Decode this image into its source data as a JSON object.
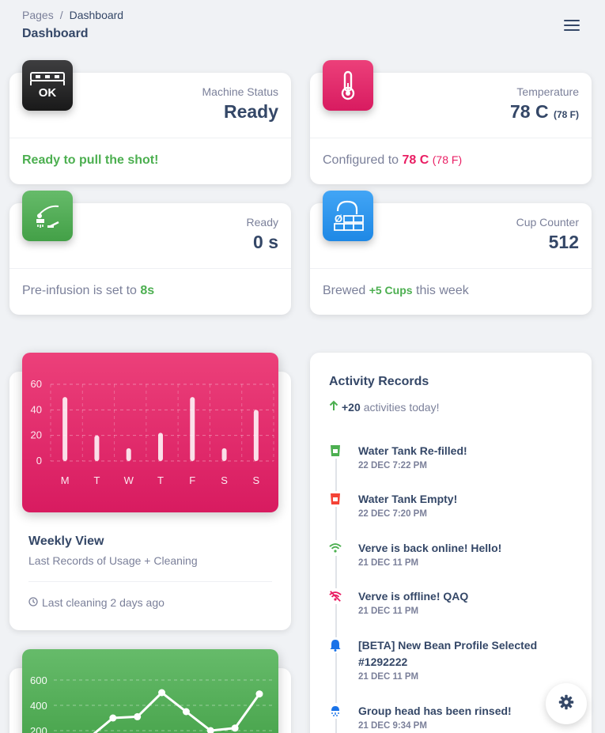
{
  "breadcrumb": {
    "root": "Pages",
    "separator": "/",
    "current": "Dashboard"
  },
  "page_title": "Dashboard",
  "stats": {
    "machine": {
      "label": "Machine Status",
      "value": "Ready",
      "footer": "Ready to pull the shot!",
      "icon": "machine-ok-icon",
      "icon_text": "OK"
    },
    "temperature": {
      "label": "Temperature",
      "value": "78 C",
      "value_sub": "(78 F)",
      "footer_prefix": "Configured to",
      "footer_value": "78 C",
      "footer_sub": "(78 F)",
      "icon": "thermometer-icon"
    },
    "ready": {
      "label": "Ready",
      "value": "0 s",
      "footer_prefix": "Pre-infusion is set to",
      "footer_value": "8s",
      "icon": "group-head-icon"
    },
    "cups": {
      "label": "Cup Counter",
      "value": "512",
      "footer_prefix": "Brewed",
      "footer_value": "+5 Cups",
      "footer_suffix": "this week",
      "icon": "cup-counter-icon",
      "icon_text": "Ø"
    }
  },
  "weekly": {
    "title": "Weekly View",
    "subtitle": "Last Records of Usage + Cleaning",
    "footer": "Last cleaning 2 days ago"
  },
  "chart_data": [
    {
      "type": "bar",
      "categories": [
        "M",
        "T",
        "W",
        "T",
        "F",
        "S",
        "S"
      ],
      "values": [
        50,
        20,
        10,
        22,
        50,
        10,
        40
      ],
      "ylim": [
        0,
        60
      ],
      "yticks": [
        0,
        20,
        40,
        60
      ],
      "grid": true,
      "color": "#e91e63"
    },
    {
      "type": "line",
      "ylim": [
        200,
        600
      ],
      "yticks": [
        200,
        400,
        600
      ],
      "values": [
        140,
        300,
        310,
        500,
        350,
        200,
        220,
        490
      ],
      "grid": true,
      "color": "#4caf50"
    }
  ],
  "activity": {
    "title": "Activity Records",
    "summary_value": "+20",
    "summary_text": "activities today!",
    "items": [
      {
        "title": "Water Tank Re-filled!",
        "date": "22 DEC 7:22 PM",
        "icon": "water-tank-full-icon",
        "color": "#4caf50"
      },
      {
        "title": "Water Tank Empty!",
        "date": "22 DEC 7:20 PM",
        "icon": "water-tank-empty-icon",
        "color": "#f44336"
      },
      {
        "title": "Verve is back online! Hello!",
        "date": "21 DEC 11 PM",
        "icon": "wifi-icon",
        "color": "#4caf50"
      },
      {
        "title": "Verve is offline! QAQ",
        "date": "21 DEC 11 PM",
        "icon": "wifi-off-icon",
        "color": "#e91e63"
      },
      {
        "title": "[BETA] New Bean Profile Selected #1292222",
        "date": "21 DEC 11 PM",
        "icon": "bell-icon",
        "color": "#1a73e8"
      },
      {
        "title": "Group head has been rinsed!",
        "date": "21 DEC 9:34 PM",
        "icon": "rinse-icon",
        "color": "#1a73e8"
      }
    ]
  },
  "settings_icon": "gear-icon"
}
